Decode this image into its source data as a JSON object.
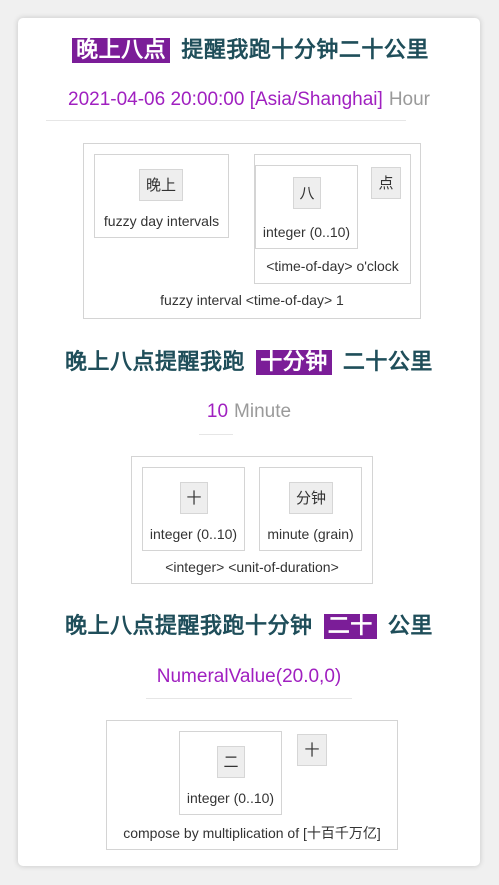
{
  "parse1": {
    "sentence_hl": "晚上八点",
    "sentence_rest": "提醒我跑十分钟二十公里",
    "value": "2021-04-06 20:00:00 [Asia/Shanghai]",
    "grain": "Hour",
    "outer_label": "fuzzy interval <time-of-day> 1",
    "sub1": {
      "token": "晚上",
      "label": "fuzzy day intervals"
    },
    "sub2": {
      "token": "八",
      "label": "integer (0..10)",
      "outer_label": "<time-of-day> o'clock",
      "extra_token": "点"
    }
  },
  "parse2": {
    "sentence_pre": "晚上八点提醒我跑",
    "sentence_hl": "十分钟",
    "sentence_post": "二十公里",
    "value": "10",
    "grain": "Minute",
    "outer_label": "<integer> <unit-of-duration>",
    "sub1": {
      "token": "十",
      "label": "integer (0..10)"
    },
    "sub2": {
      "token": "分钟",
      "label": "minute (grain)"
    }
  },
  "parse3": {
    "sentence_pre": "晚上八点提醒我跑十分钟",
    "sentence_hl": "二十",
    "sentence_post": "公里",
    "value": "NumeralValue(20.0,0)",
    "outer_label": "compose by multiplication of [十百千万亿]",
    "sub1": {
      "token": "二",
      "label": "integer (0..10)"
    },
    "extra_token": "十"
  }
}
